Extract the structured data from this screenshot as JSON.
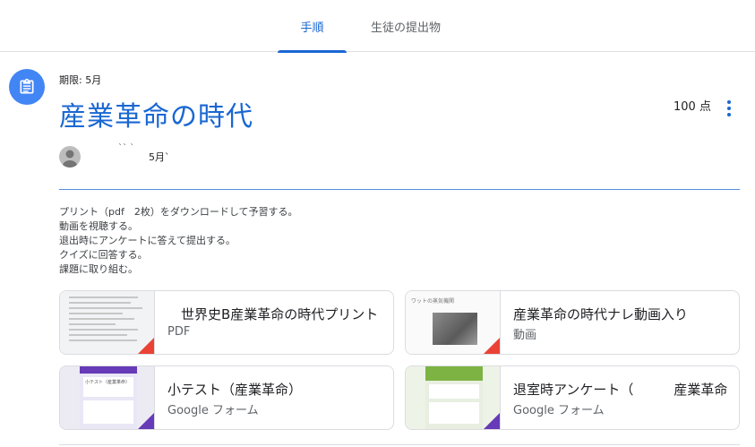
{
  "tabs": [
    {
      "label": "手順",
      "active": true
    },
    {
      "label": "生徒の提出物",
      "active": false
    }
  ],
  "assignment": {
    "due": "期限: 5月",
    "title": "産業革命の時代",
    "points": "100 点",
    "author": "`` `",
    "posted": "5月`"
  },
  "instructions": [
    "プリント（pdf　2枚）をダウンロードして予習する。",
    "動画を視聴する。",
    "退出時にアンケートに答えて提出する。",
    "クイズに回答する。",
    "課題に取り組む。"
  ],
  "attachments": [
    {
      "title": "　世界史B産業革命の時代プリント",
      "type": "PDF",
      "accent": "#ea4335"
    },
    {
      "title": "産業革命の時代ナレ動画入り",
      "type": "動画",
      "accent": "#ea4335"
    },
    {
      "title": "小テスト（産業革命）",
      "type": "Google フォーム",
      "accent": "#673ab7"
    },
    {
      "title": "退室時アンケート（　　　産業革命",
      "type": "Google フォーム",
      "accent": "#673ab7"
    }
  ],
  "thumb_texts": {
    "video_caption": "ワットの蒸気機関",
    "quiz_caption": "小テスト（産業革命）"
  },
  "colors": {
    "accent_blue": "#1967d2",
    "icon_bg": "#4285f4"
  }
}
